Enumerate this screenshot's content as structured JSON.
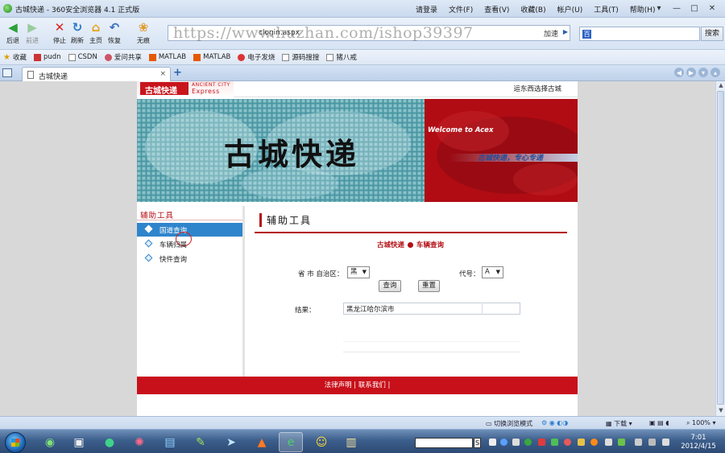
{
  "window": {
    "title": "古城快递 - 360安全浏览器 4.1 正式版",
    "menus": [
      "请登录",
      "文件(F)",
      "查看(V)",
      "收藏(B)",
      "帐户(U)",
      "工具(T)",
      "帮助(H)"
    ],
    "controls": [
      "▾",
      "—",
      "□",
      "✕"
    ]
  },
  "toolbar": {
    "buttons": [
      {
        "label": "后退",
        "icon": "back-arrow-icon"
      },
      {
        "label": "前进",
        "icon": "forward-arrow-icon"
      },
      {
        "label": "停止",
        "icon": "stop-icon"
      },
      {
        "label": "刷新",
        "icon": "refresh-icon"
      },
      {
        "label": "主页",
        "icon": "home-icon"
      },
      {
        "label": "恢复",
        "icon": "undo-icon"
      },
      {
        "label": "无痕",
        "icon": "incognito-paw-icon"
      }
    ],
    "address": "clogin.aspx",
    "watermark": "https://www.huzhan.com/ishop39397",
    "go_label": "加速",
    "search_button": "搜索"
  },
  "favorites": {
    "items": [
      {
        "label": "收藏",
        "icon": "star-icon",
        "color": "#e0a000"
      },
      {
        "label": "pudn",
        "icon": "pudn-icon",
        "color": "#c33"
      },
      {
        "label": "CSDN",
        "icon": "page-icon",
        "color": "#ccc"
      },
      {
        "label": "爱问共享",
        "icon": "share-icon",
        "color": "#c56"
      },
      {
        "label": "MATLAB",
        "icon": "matlab-icon",
        "color": "#e55a00"
      },
      {
        "label": "MATLAB",
        "icon": "matlab-icon",
        "color": "#e55a00"
      },
      {
        "label": "电子发烧",
        "icon": "elec-icon",
        "color": "#d33"
      },
      {
        "label": "源码搜搜",
        "icon": "page-icon",
        "color": "#ccc"
      },
      {
        "label": "猪八戒",
        "icon": "page-icon",
        "color": "#ccc"
      }
    ]
  },
  "tabs": {
    "active_label": "古城快递",
    "new_tab": "+"
  },
  "site": {
    "logo_cn": "古城快递",
    "logo_en_1": "ANCIENT CITY",
    "logo_en_2": "Express",
    "slogan": "运东西选择古城",
    "banner_title": "古城快递",
    "welcome": "Welcome to  Acex",
    "motto": "古城快递，专心专递",
    "nav": {
      "heading": "辅助工具",
      "items": [
        {
          "label": "国道查询",
          "active": true
        },
        {
          "label": "车辆归属",
          "active": false
        },
        {
          "label": "快件查询",
          "active": false
        }
      ]
    },
    "main": {
      "title": "辅助工具",
      "crumb_left": "古城快递",
      "crumb_right": "车辆查询",
      "province_label": "省 市 自治区：",
      "province_value": "黑",
      "code_label": "代号：",
      "code_value": "A",
      "query_button": "查询",
      "reset_button": "重置",
      "result_label": "结果：",
      "result_value": "黑龙江哈尔滨市"
    },
    "footer": "法律声明 | 联系我们 |"
  },
  "statusbar": {
    "mode": "切换浏览模式",
    "download": "下载",
    "zoom": "100%"
  },
  "taskbar": {
    "time": "7:01",
    "date": "2012/4/15",
    "ime": "S"
  }
}
